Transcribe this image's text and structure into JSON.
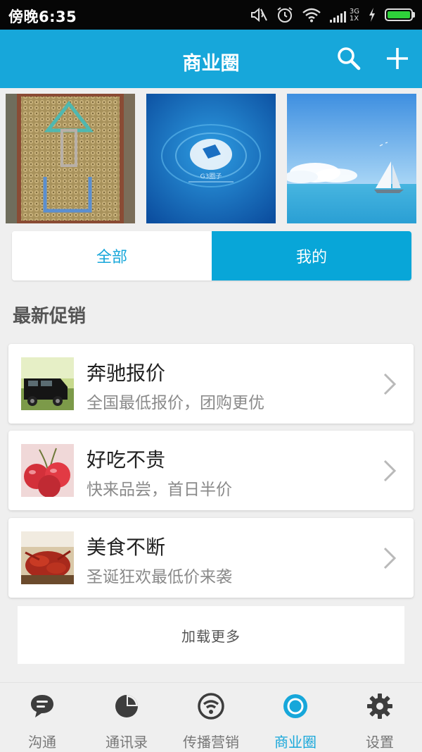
{
  "status_bar": {
    "time": "傍晚6:35",
    "network": "3G",
    "network_sub": "1X",
    "icons": [
      "mute-icon",
      "alarm-icon",
      "wifi-icon",
      "signal-icon",
      "charging-icon",
      "battery-icon"
    ]
  },
  "header": {
    "title": "商业圈",
    "actions": [
      "search-icon",
      "add-icon"
    ]
  },
  "banners": {
    "tiles": [
      "photo-mosaic",
      "app-promo",
      "sailboat-sky"
    ],
    "promo_caption": "G3圈子"
  },
  "segment": {
    "all_label": "全部",
    "mine_label": "我的",
    "selected": "我的"
  },
  "section": {
    "title": "最新促销"
  },
  "promos": [
    {
      "title": "奔驰报价",
      "subtitle": "全国最低报价，团购更优",
      "thumb": "suv-photo"
    },
    {
      "title": "好吃不贵",
      "subtitle": "快来品尝，首日半价",
      "thumb": "cherry-photo"
    },
    {
      "title": "美食不断",
      "subtitle": "圣诞狂欢最低价来袭",
      "thumb": "lobster-photo"
    }
  ],
  "load_more": {
    "label": "加载更多"
  },
  "tabs": [
    {
      "label": "沟通",
      "icon": "chat-bubble-icon"
    },
    {
      "label": "通讯录",
      "icon": "pie-chart-icon"
    },
    {
      "label": "传播营销",
      "icon": "broadcast-icon"
    },
    {
      "label": "商业圈",
      "icon": "business-circle-icon"
    },
    {
      "label": "设置",
      "icon": "gear-icon"
    }
  ],
  "active_tab": "商业圈",
  "colors": {
    "accent": "#17a7da",
    "status_bar": "#060606",
    "background": "#efefef",
    "tab_icon": "#3d3d3d"
  }
}
